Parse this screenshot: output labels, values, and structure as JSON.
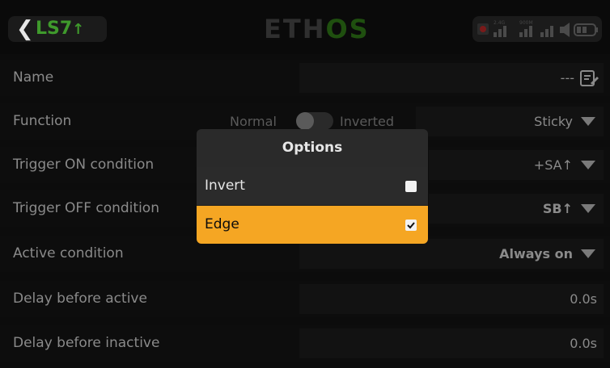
{
  "header": {
    "back_label": "<",
    "title": "LS7",
    "title_arrow": "↑",
    "logo_left": "ETH",
    "logo_highlight": "OS",
    "status": {
      "rf_24": "2.4G",
      "rf_900": "900M"
    }
  },
  "rows": {
    "name": {
      "label": "Name",
      "value": "---"
    },
    "function": {
      "label": "Function",
      "toggle_left": "Normal",
      "toggle_right": "Inverted",
      "value": "Sticky"
    },
    "trigger_on": {
      "label": "Trigger ON condition",
      "value": "SA↑",
      "prefix": "+"
    },
    "trigger_off": {
      "label": "Trigger OFF condition",
      "value": "SB↑"
    },
    "active": {
      "label": "Active condition",
      "value": "Always on"
    },
    "delay_active": {
      "label": "Delay before active",
      "value": "0.0s"
    },
    "delay_inactive": {
      "label": "Delay before inactive",
      "value": "0.0s"
    }
  },
  "dialog": {
    "title": "Options",
    "options": [
      {
        "label": "Invert",
        "checked": false
      },
      {
        "label": "Edge",
        "checked": true
      }
    ],
    "colors": {
      "selected_bg": "#f5a623",
      "dialog_bg": "#1c1c1c",
      "header_bg": "#2a2a2a"
    }
  },
  "colors": {
    "accent_green": "#3f9a2c",
    "background": "#0c0c0c",
    "text_muted": "#8a8a8a",
    "highlight_orange": "#f5a623"
  },
  "icons": {
    "back": "chevron-left-icon",
    "edit": "edit-note-icon",
    "dropdown": "caret-down-icon",
    "record": "record-icon",
    "signal": "signal-bars-icon",
    "speaker": "speaker-icon",
    "battery": "battery-icon",
    "checkbox": "checkbox-icon"
  }
}
